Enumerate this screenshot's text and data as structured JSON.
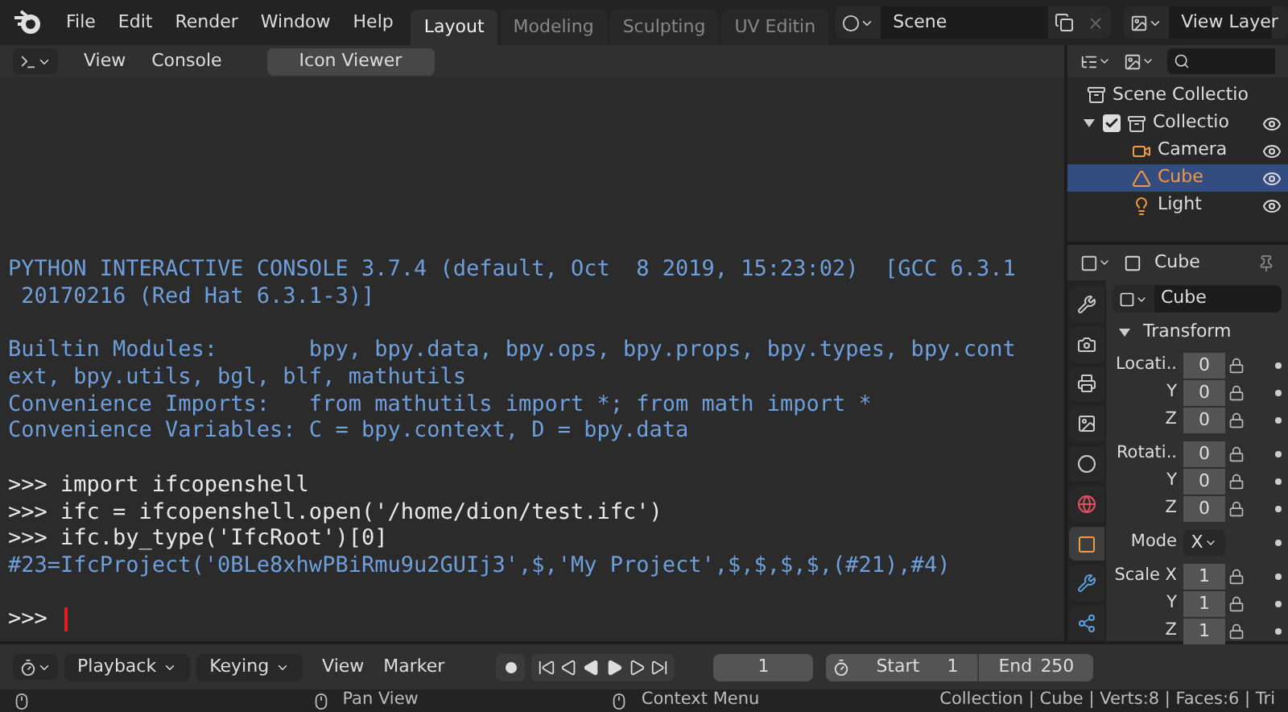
{
  "menu": {
    "items": [
      "File",
      "Edit",
      "Render",
      "Window",
      "Help"
    ]
  },
  "workspace_tabs": [
    {
      "label": "Layout",
      "selected": true
    },
    {
      "label": "Modeling",
      "selected": false
    },
    {
      "label": "Sculpting",
      "selected": false
    },
    {
      "label": "UV Editin",
      "selected": false
    }
  ],
  "scene": {
    "value": "Scene"
  },
  "view_layer": {
    "value": "View Layer"
  },
  "console": {
    "menus": [
      "View",
      "Console"
    ],
    "button": "Icon Viewer",
    "lines": [
      {
        "kind": "output",
        "text": "PYTHON INTERACTIVE CONSOLE 3.7.4 (default, Oct  8 2019, 15:23:02)  [GCC 6.3.1"
      },
      {
        "kind": "output",
        "text": " 20170216 (Red Hat 6.3.1-3)]"
      },
      {
        "kind": "gap"
      },
      {
        "kind": "output",
        "text": "Builtin Modules:       bpy, bpy.data, bpy.ops, bpy.props, bpy.types, bpy.cont"
      },
      {
        "kind": "output",
        "text": "ext, bpy.utils, bgl, blf, mathutils"
      },
      {
        "kind": "output",
        "text": "Convenience Imports:   from mathutils import *; from math import *"
      },
      {
        "kind": "output",
        "text": "Convenience Variables: C = bpy.context, D = bpy.data"
      },
      {
        "kind": "gap"
      },
      {
        "kind": "input",
        "text": ">>> import ifcopenshell"
      },
      {
        "kind": "input",
        "text": ">>> ifc = ifcopenshell.open('/home/dion/test.ifc')"
      },
      {
        "kind": "input",
        "text": ">>> ifc.by_type('IfcRoot')[0]"
      },
      {
        "kind": "output",
        "text": "#23=IfcProject('0BLe8xhwPBiRmu9u2GUIj3',$,'My Project',$,$,$,$,(#21),#4)"
      },
      {
        "kind": "gap"
      },
      {
        "kind": "prompt",
        "text": ">>> "
      }
    ]
  },
  "outliner": {
    "root": "Scene Collectio",
    "items": [
      {
        "label": "Collectio",
        "checked": true,
        "selected": false,
        "kind": "collection",
        "children": [
          {
            "label": "Camera",
            "selected": false,
            "kind": "camera"
          },
          {
            "label": "Cube",
            "selected": true,
            "kind": "mesh"
          },
          {
            "label": "Light",
            "selected": false,
            "kind": "light"
          }
        ]
      }
    ]
  },
  "properties": {
    "title": "Cube",
    "name": "Cube",
    "panel": "Transform",
    "tabs": [
      {
        "kind": "tool",
        "selected": false
      },
      {
        "kind": "render",
        "selected": false
      },
      {
        "kind": "output",
        "selected": false
      },
      {
        "kind": "view_layer",
        "selected": false
      },
      {
        "kind": "scene",
        "selected": false
      },
      {
        "kind": "world",
        "selected": false
      },
      {
        "kind": "object",
        "selected": true
      },
      {
        "kind": "modifier",
        "selected": false
      },
      {
        "kind": "particles",
        "selected": false
      }
    ],
    "groups": [
      [
        {
          "kind": "number",
          "label": "Locati..",
          "value": "0"
        },
        {
          "kind": "number",
          "label": "Y",
          "value": "0"
        },
        {
          "kind": "number",
          "label": "Z",
          "value": "0"
        }
      ],
      [
        {
          "kind": "number",
          "label": "Rotati..",
          "value": "0"
        },
        {
          "kind": "number",
          "label": "Y",
          "value": "0"
        },
        {
          "kind": "number",
          "label": "Z",
          "value": "0"
        }
      ],
      [
        {
          "kind": "select",
          "label": "Mode",
          "value": "X"
        }
      ],
      [
        {
          "kind": "number",
          "label": "Scale X",
          "value": "1"
        },
        {
          "kind": "number",
          "label": "Y",
          "value": "1"
        },
        {
          "kind": "number",
          "label": "Z",
          "value": "1"
        }
      ]
    ]
  },
  "timeline": {
    "dropdowns": [
      "Playback",
      "Keying"
    ],
    "menus": [
      "View",
      "Marker"
    ],
    "frame": "1",
    "start_label": "Start",
    "start": "1",
    "end_label": "End",
    "end": "250"
  },
  "status_bar": {
    "hints": [
      {
        "kind": "left"
      },
      {
        "kind": "middle",
        "label": "Pan View"
      },
      {
        "kind": "right",
        "label": "Context Menu"
      }
    ],
    "info": "Collection | Cube | Verts:8 | Faces:6 | Tri"
  }
}
